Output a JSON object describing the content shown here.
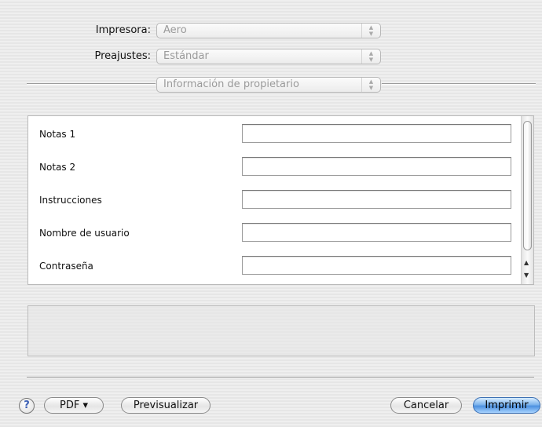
{
  "header": {
    "printer_label": "Impresora:",
    "printer_value": "Aero",
    "presets_label": "Preajustes:",
    "presets_value": "Estándar",
    "section_value": "Información de propietario"
  },
  "form": {
    "rows": [
      {
        "label": "Notas 1",
        "value": ""
      },
      {
        "label": "Notas 2",
        "value": ""
      },
      {
        "label": "Instrucciones",
        "value": ""
      },
      {
        "label": "Nombre de usuario",
        "value": ""
      },
      {
        "label": "Contraseña",
        "value": ""
      }
    ]
  },
  "footer": {
    "help_label": "?",
    "pdf_label": "PDF ▾",
    "preview_label": "Previsualizar",
    "cancel_label": "Cancelar",
    "print_label": "Imprimir"
  },
  "icons": {
    "popup_arrows": "up-down-arrows-icon",
    "scroll_up": "scroll-up-arrow-icon",
    "scroll_down": "scroll-down-arrow-icon"
  },
  "colors": {
    "default_button": "#4c91e0",
    "background": "#ececec"
  }
}
